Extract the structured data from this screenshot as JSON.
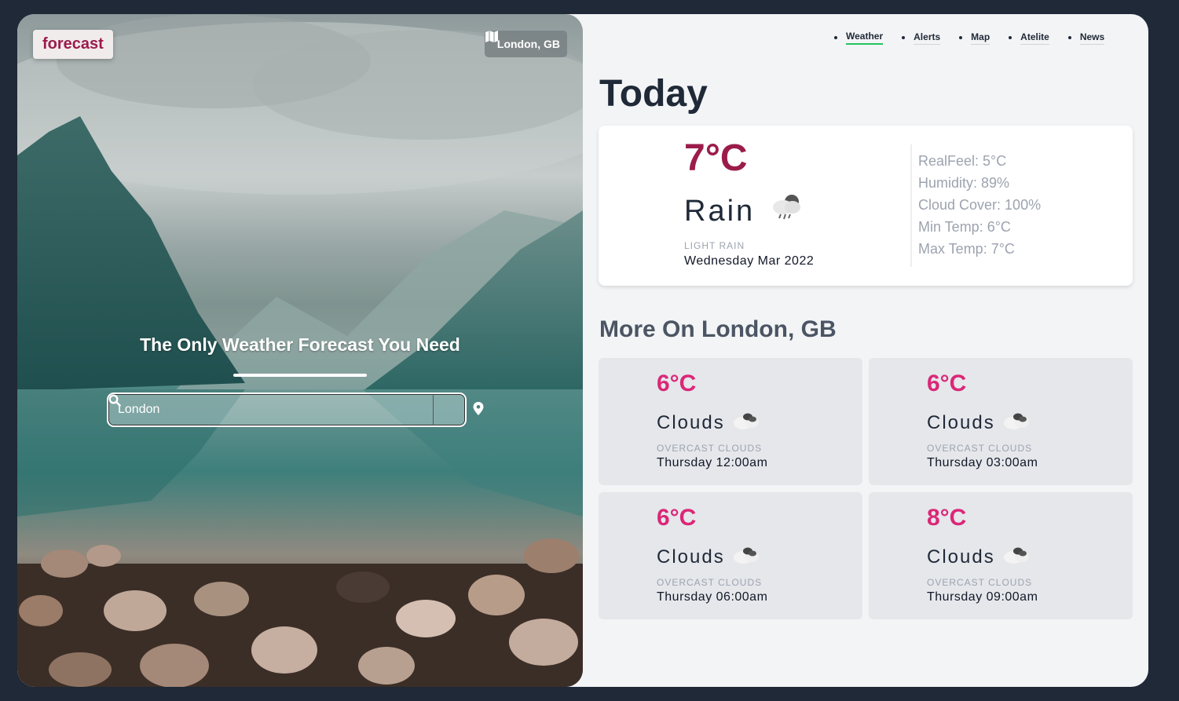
{
  "hero": {
    "logo": "forecast",
    "location_chip": "London, GB",
    "tagline": "The Only Weather Forecast You Need",
    "search": {
      "value": "London",
      "placeholder": ""
    }
  },
  "nav": {
    "items": [
      {
        "label": "Weather",
        "active": true
      },
      {
        "label": "Alerts"
      },
      {
        "label": "Map"
      },
      {
        "label": "Atelite"
      },
      {
        "label": "News"
      }
    ]
  },
  "today": {
    "heading": "Today",
    "temp": "7°C",
    "condition": "Rain",
    "condition_icon": "rain-cloud-icon",
    "description": "LIGHT RAIN",
    "date": "Wednesday Mar 2022",
    "stats": {
      "realfeel": "RealFeel: 5°C",
      "humidity": "Humidity: 89%",
      "cloud_cover": "Cloud Cover: 100%",
      "min_temp": "Min Temp: 6°C",
      "max_temp": "Max Temp: 7°C"
    }
  },
  "more": {
    "heading": "More On London, GB",
    "cards": [
      {
        "temp": "6°C",
        "condition": "Clouds",
        "icon": "clouds-icon",
        "description": "OVERCAST CLOUDS",
        "time": "Thursday 12:00am"
      },
      {
        "temp": "6°C",
        "condition": "Clouds",
        "icon": "clouds-icon",
        "description": "OVERCAST CLOUDS",
        "time": "Thursday 03:00am"
      },
      {
        "temp": "6°C",
        "condition": "Clouds",
        "icon": "clouds-icon",
        "description": "OVERCAST CLOUDS",
        "time": "Thursday 06:00am"
      },
      {
        "temp": "8°C",
        "condition": "Clouds",
        "icon": "clouds-icon",
        "description": "OVERCAST CLOUDS",
        "time": "Thursday 09:00am"
      }
    ]
  },
  "colors": {
    "brand": "#9b1c4b",
    "card_temp": "#db2777",
    "nav_active": "#22c55e",
    "page_bg": "#1f2937"
  }
}
